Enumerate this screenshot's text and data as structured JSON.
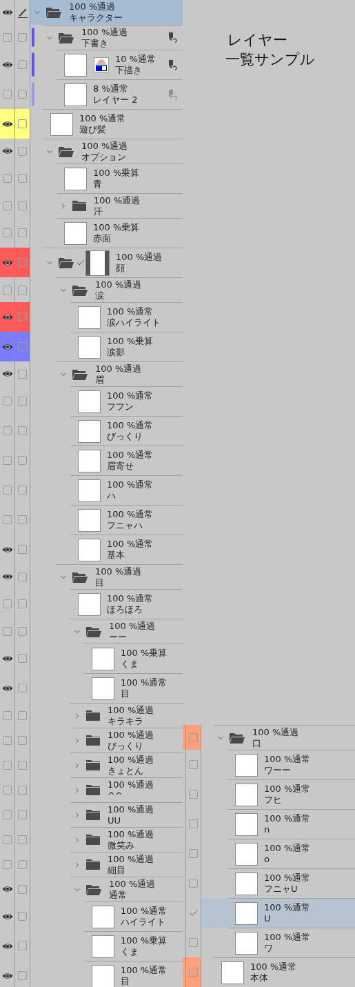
{
  "title_lines": [
    "レイヤー",
    "一覧サンプル"
  ],
  "panel": {
    "layers": [
      {
        "kind": "folder",
        "mode": "100 %通過",
        "name": "キャラクター",
        "visible": true,
        "selected": true,
        "expanded": true,
        "editing": true,
        "children": [
          {
            "kind": "folder",
            "mode": "100 %通過",
            "name": "下書き",
            "visible": false,
            "selected": false,
            "expanded": true,
            "checked": false,
            "bar": {
              "color": "#5a5ae8"
            },
            "reference": true,
            "reference_dim": false,
            "children": [
              {
                "kind": "layer",
                "mode": "10 %通常",
                "name": "下描き",
                "visible": true,
                "selected": false,
                "checked": false,
                "bar": {
                  "color": "#5a5ae8"
                },
                "layer_color": true,
                "reference": true,
                "reference_dim": false
              },
              {
                "kind": "layer",
                "mode": "8 %通常",
                "name": "レイヤー 2",
                "visible": false,
                "selected": false,
                "checked": false,
                "bar": {
                  "color": "#9a9ae0"
                },
                "reference": true,
                "reference_dim": true
              }
            ]
          },
          {
            "kind": "layer",
            "mode": "100 %通常",
            "name": "遊び髪",
            "visible": true,
            "selected": false,
            "checked": false,
            "color": "#ffff80"
          },
          {
            "kind": "folder",
            "mode": "100 %通過",
            "name": "オプション",
            "visible": true,
            "selected": false,
            "expanded": true,
            "checked": false,
            "children": [
              {
                "kind": "layer",
                "mode": "100 %乗算",
                "name": "青",
                "visible": false,
                "selected": false,
                "checked": false
              },
              {
                "kind": "folder",
                "mode": "100 %通過",
                "name": "汗",
                "visible": false,
                "selected": false,
                "expanded": false,
                "checked": false
              },
              {
                "kind": "layer",
                "mode": "100 %乗算",
                "name": "赤面",
                "visible": false,
                "selected": false,
                "checked": false
              }
            ]
          },
          {
            "kind": "folder",
            "mode": "100 %通過",
            "name": "顔",
            "visible": true,
            "selected": false,
            "expanded": true,
            "checked": false,
            "mask": true,
            "color": "#ff5a5a",
            "children": [
              {
                "kind": "folder",
                "mode": "100 %通過",
                "name": "涙",
                "visible": false,
                "selected": false,
                "expanded": true,
                "checked": false,
                "children": [
                  {
                    "kind": "layer",
                    "mode": "100 %通常",
                    "name": "涙ハイライト",
                    "visible": true,
                    "selected": false,
                    "checked": false,
                    "color": "#ff5a5a"
                  },
                  {
                    "kind": "layer",
                    "mode": "100 %乗算",
                    "name": "涙影",
                    "visible": true,
                    "selected": false,
                    "checked": false,
                    "color": "#7b7bff"
                  }
                ]
              },
              {
                "kind": "folder",
                "mode": "100 %通過",
                "name": "眉",
                "visible": true,
                "selected": false,
                "expanded": true,
                "checked": false,
                "children": [
                  {
                    "kind": "layer",
                    "mode": "100 %通常",
                    "name": "フフン",
                    "visible": false,
                    "selected": false,
                    "checked": false
                  },
                  {
                    "kind": "layer",
                    "mode": "100 %通常",
                    "name": "びっくり",
                    "visible": false,
                    "selected": false,
                    "checked": false
                  },
                  {
                    "kind": "layer",
                    "mode": "100 %通常",
                    "name": "眉寄せ",
                    "visible": false,
                    "selected": false,
                    "checked": false
                  },
                  {
                    "kind": "layer",
                    "mode": "100 %通常",
                    "name": "ハ",
                    "visible": false,
                    "selected": false,
                    "checked": false
                  },
                  {
                    "kind": "layer",
                    "mode": "100 %通常",
                    "name": "フニャハ",
                    "visible": false,
                    "selected": false,
                    "checked": false
                  },
                  {
                    "kind": "layer",
                    "mode": "100 %通常",
                    "name": "基本",
                    "visible": true,
                    "selected": false,
                    "checked": false
                  }
                ]
              },
              {
                "kind": "folder",
                "mode": "100 %通過",
                "name": "目",
                "visible": true,
                "selected": false,
                "expanded": true,
                "checked": false,
                "children": [
                  {
                    "kind": "layer",
                    "mode": "100 %通常",
                    "name": "ほろほろ",
                    "visible": false,
                    "selected": false,
                    "checked": false
                  },
                  {
                    "kind": "folder",
                    "mode": "100 %通過",
                    "name": "ーー",
                    "visible": false,
                    "selected": false,
                    "expanded": true,
                    "checked": false,
                    "children": [
                      {
                        "kind": "layer",
                        "mode": "100 %乗算",
                        "name": "くま",
                        "visible": true,
                        "selected": false,
                        "checked": false
                      },
                      {
                        "kind": "layer",
                        "mode": "100 %通常",
                        "name": "目",
                        "visible": true,
                        "selected": false,
                        "checked": false
                      }
                    ]
                  },
                  {
                    "kind": "folder",
                    "mode": "100 %通過",
                    "name": "キラキラ",
                    "visible": false,
                    "selected": false,
                    "expanded": false,
                    "checked": false
                  },
                  {
                    "kind": "folder",
                    "mode": "100 %通過",
                    "name": "びっくり",
                    "visible": false,
                    "selected": false,
                    "expanded": false,
                    "checked": false
                  },
                  {
                    "kind": "folder",
                    "mode": "100 %通過",
                    "name": "きょとん",
                    "visible": false,
                    "selected": false,
                    "expanded": false,
                    "checked": false
                  },
                  {
                    "kind": "folder",
                    "mode": "100 %通過",
                    "name": "^^",
                    "visible": false,
                    "selected": false,
                    "expanded": false,
                    "checked": false
                  },
                  {
                    "kind": "folder",
                    "mode": "100 %通過",
                    "name": "UU",
                    "visible": false,
                    "selected": false,
                    "expanded": false,
                    "checked": false
                  },
                  {
                    "kind": "folder",
                    "mode": "100 %通過",
                    "name": "微笑み",
                    "visible": false,
                    "selected": false,
                    "expanded": false,
                    "checked": false
                  },
                  {
                    "kind": "folder",
                    "mode": "100 %通過",
                    "name": "細目",
                    "visible": false,
                    "selected": false,
                    "expanded": false,
                    "checked": false
                  },
                  {
                    "kind": "folder",
                    "mode": "100 %通過",
                    "name": "通常",
                    "visible": true,
                    "selected": false,
                    "expanded": true,
                    "checked": false,
                    "children": [
                      {
                        "kind": "layer",
                        "mode": "100 %通常",
                        "name": "ハイライト",
                        "visible": true,
                        "selected": false,
                        "checked": false
                      },
                      {
                        "kind": "layer",
                        "mode": "100 %乗算",
                        "name": "くま",
                        "visible": true,
                        "selected": false,
                        "checked": false
                      },
                      {
                        "kind": "layer",
                        "mode": "100 %通常",
                        "name": "目",
                        "visible": true,
                        "selected": false,
                        "checked": false
                      }
                    ]
                  }
                ]
              }
            ]
          }
        ]
      }
    ]
  },
  "continued_panel": {
    "layers": [
      {
        "kind": "folder",
        "mode": "100 %通過",
        "name": "口",
        "selected": false,
        "expanded": true,
        "checked": false,
        "color": "#ffa07a",
        "children": [
          {
            "kind": "layer",
            "mode": "100 %通常",
            "name": "ワーー",
            "selected": false,
            "checked": false
          },
          {
            "kind": "layer",
            "mode": "100 %通常",
            "name": "フヒ",
            "selected": false,
            "checked": false
          },
          {
            "kind": "layer",
            "mode": "100 %通常",
            "name": "n",
            "selected": false,
            "checked": false
          },
          {
            "kind": "layer",
            "mode": "100 %通常",
            "name": "o",
            "selected": false,
            "checked": false
          },
          {
            "kind": "layer",
            "mode": "100 %通常",
            "name": "フニャU",
            "selected": false,
            "checked": false
          },
          {
            "kind": "layer",
            "mode": "100 %通常",
            "name": "U",
            "selected": true,
            "checked": true
          },
          {
            "kind": "layer",
            "mode": "100 %通常",
            "name": "ワ",
            "selected": false,
            "checked": false
          }
        ]
      },
      {
        "kind": "layer",
        "mode": "100 %通常",
        "name": "本体",
        "selected": false,
        "checked": false,
        "color": "#ffa07a"
      }
    ]
  }
}
